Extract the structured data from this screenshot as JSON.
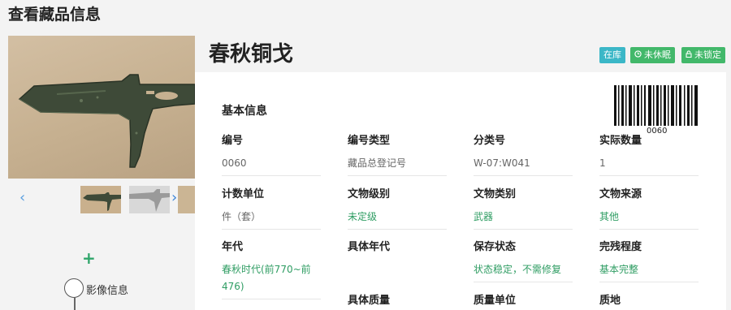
{
  "page": {
    "title": "查看藏品信息"
  },
  "gallery": {
    "image_alt": "春秋铜戈 photo",
    "prev_icon": "chevron-left-icon",
    "next_icon": "chevron-right-icon",
    "thumbnails_count": 3
  },
  "sidebar_timeline": {
    "add_icon": "plus-icon",
    "items": [
      {
        "label": "影像信息"
      }
    ]
  },
  "item": {
    "title": "春秋铜戈",
    "badges": [
      {
        "label": "在库",
        "color": "#3bb7c7"
      },
      {
        "label": "未休眠",
        "icon": "clock-icon",
        "color": "#42b86a"
      },
      {
        "label": "未锁定",
        "icon": "unlock-icon",
        "color": "#42b86a"
      }
    ]
  },
  "basic_info": {
    "section_title": "基本信息",
    "barcode_number": "0060",
    "fields": [
      {
        "label": "编号",
        "value": "0060"
      },
      {
        "label": "编号类型",
        "value": "藏品总登记号"
      },
      {
        "label": "分类号",
        "value": "W-07:W041"
      },
      {
        "label": "实际数量",
        "value": "1"
      },
      {
        "label": "计数单位",
        "value": "件（套）"
      },
      {
        "label": "文物级别",
        "value": "未定级"
      },
      {
        "label": "文物类别",
        "value": "武器"
      },
      {
        "label": "文物来源",
        "value": "其他"
      },
      {
        "label": "年代",
        "value": "春秋时代(前770~前476)"
      },
      {
        "label": "具体年代",
        "value": ""
      },
      {
        "label": "保存状态",
        "value": "状态稳定，不需修复"
      },
      {
        "label": "完残程度",
        "value": "基本完整"
      },
      {
        "label": "具体质量",
        "value": ""
      },
      {
        "label": "质量单位",
        "value": ""
      },
      {
        "label": "质地",
        "value": ""
      }
    ]
  },
  "colors": {
    "accent_green": "#2f9d63",
    "badge_teal": "#3bb7c7",
    "badge_green": "#42b86a",
    "link_blue": "#3d86d8"
  }
}
